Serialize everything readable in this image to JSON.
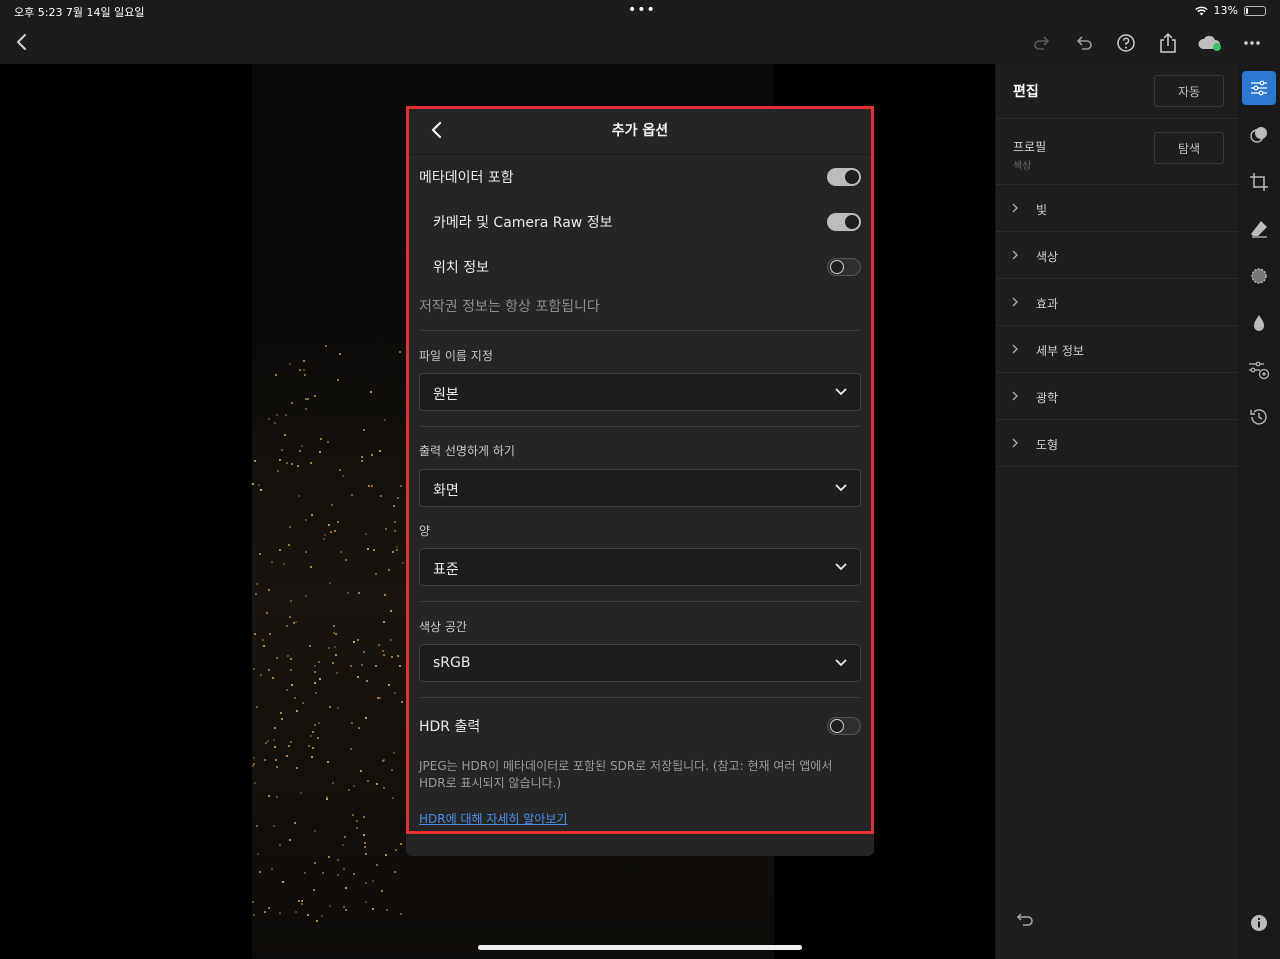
{
  "status_bar": {
    "time": "오후 5:23   7월 14일 일요일",
    "center_dots": "•••",
    "battery_text": "13%",
    "battery_level": 0.13
  },
  "toolbar": {
    "icons": [
      "redo-icon",
      "undo-icon",
      "help-icon",
      "share-icon",
      "cloud-sync-icon",
      "more-icon"
    ]
  },
  "panel": {
    "title": "편집",
    "auto_button": "자동",
    "profile_label": "프로필",
    "profile_value": "색상",
    "browse_button": "탐색",
    "sections": [
      {
        "label": "빛"
      },
      {
        "label": "색상"
      },
      {
        "label": "효과"
      },
      {
        "label": "세부 정보"
      },
      {
        "label": "광학"
      },
      {
        "label": "도형"
      }
    ]
  },
  "rail": {
    "icons": [
      "edit-sliders-icon",
      "masking-icon",
      "crop-icon",
      "healing-icon",
      "selective-icon",
      "color-drop-icon",
      "presets-icon",
      "history-icon"
    ]
  },
  "dialog": {
    "title": "추가 옵션",
    "metadata_label": "메타데이터 포함",
    "metadata_on": true,
    "camera_raw_label": "카메라 및 Camera Raw 정보",
    "camera_raw_on": true,
    "location_label": "위치 정보",
    "location_on": false,
    "copyright_note": "저작권 정보는 항상 포함됩니다",
    "filename_label": "파일 이름 지정",
    "filename_value": "원본",
    "sharpen_label": "출력 선명하게 하기",
    "sharpen_value": "화면",
    "amount_label": "양",
    "amount_value": "표준",
    "colorspace_label": "색상 공간",
    "colorspace_value": "sRGB",
    "hdr_label": "HDR 출력",
    "hdr_on": false,
    "hdr_note": "JPEG는 HDR이 메타데이터로 포함된 SDR로 저장됩니다. (참고: 현재 여러 앱에서 HDR로 표시되지 않습니다.)",
    "hdr_link": "HDR에 대해 자세히 알아보기"
  }
}
